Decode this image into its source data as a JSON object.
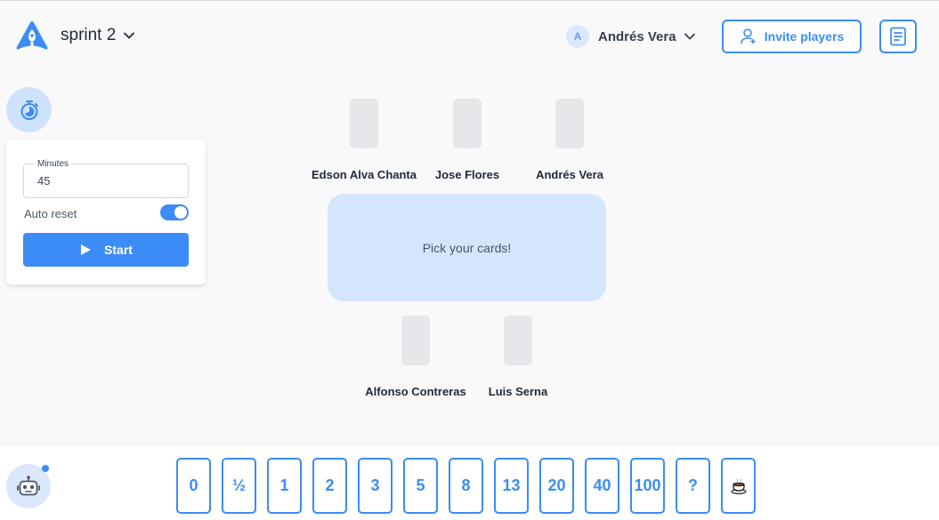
{
  "header": {
    "room_name": "sprint 2",
    "user_initial": "A",
    "user_name": "Andrés Vera",
    "invite_label": "Invite players"
  },
  "timer": {
    "minutes_label": "Minutes",
    "minutes_value": "45",
    "auto_reset_label": "Auto reset",
    "auto_reset_on": true,
    "start_label": "Start"
  },
  "players_top": [
    {
      "name": "Edson Alva Chanta"
    },
    {
      "name": "Jose Flores"
    },
    {
      "name": "Andrés Vera"
    }
  ],
  "players_bottom": [
    {
      "name": "Alfonso Contreras"
    },
    {
      "name": "Luis Serna"
    }
  ],
  "board_message": "Pick your cards!",
  "deck": [
    "0",
    "½",
    "1",
    "2",
    "3",
    "5",
    "8",
    "13",
    "20",
    "40",
    "100",
    "?",
    "☕"
  ],
  "colors": {
    "accent": "#3b8cf6",
    "board": "#d4e6fd",
    "background": "#f9f9f9"
  }
}
